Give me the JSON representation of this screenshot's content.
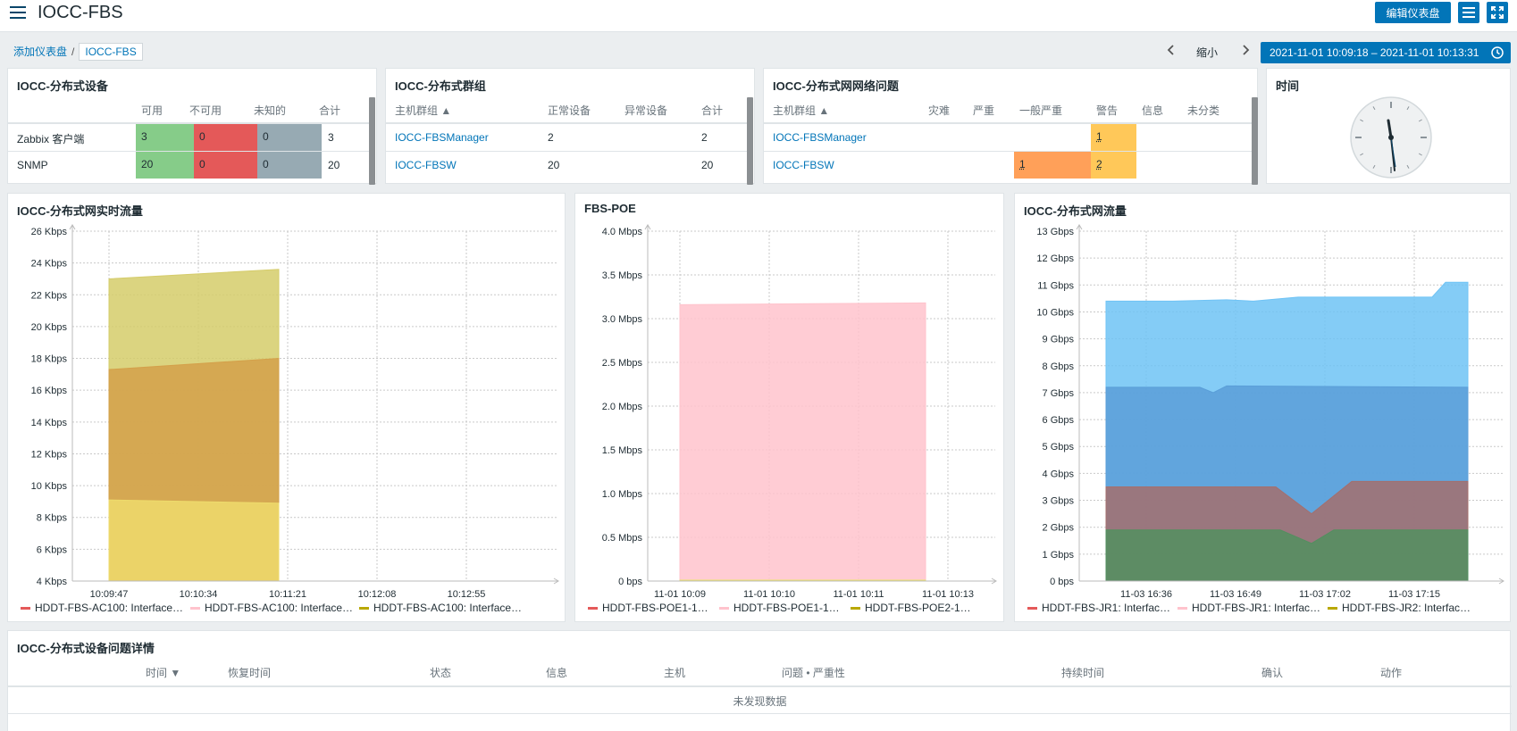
{
  "header": {
    "title": "IOCC-FBS",
    "edit_button": "编辑仪表盘"
  },
  "breadcrumb": {
    "parent": "添加仪表盘",
    "current": "IOCC-FBS"
  },
  "toolbar": {
    "zoom_label": "缩小",
    "time_range": "2021-11-01 10:09:18 – 2021-11-01 10:13:31"
  },
  "widgets": {
    "devices": {
      "title": "IOCC-分布式设备",
      "headers": [
        "可用",
        "不可用",
        "未知的",
        "合计"
      ],
      "rows": [
        {
          "name": "Zabbix 客户端",
          "available": "3",
          "unavailable": "0",
          "unknown": "0",
          "total": "3"
        },
        {
          "name": "SNMP",
          "available": "20",
          "unavailable": "0",
          "unknown": "0",
          "total": "20"
        }
      ]
    },
    "groups": {
      "title": "IOCC-分布式群组",
      "headers": [
        "主机群组 ▲",
        "正常设备",
        "异常设备",
        "合计"
      ],
      "rows": [
        {
          "name": "IOCC-FBSManager",
          "normal": "2",
          "abnormal": "",
          "total": "2"
        },
        {
          "name": "IOCC-FBSW",
          "normal": "20",
          "abnormal": "",
          "total": "20"
        }
      ]
    },
    "problems": {
      "title": "IOCC-分布式网网络问题",
      "headers": [
        "主机群组 ▲",
        "灾难",
        "严重",
        "一般严重",
        "警告",
        "信息",
        "未分类"
      ],
      "rows": [
        {
          "name": "IOCC-FBSManager",
          "average": "",
          "warning": "1"
        },
        {
          "name": "IOCC-FBSW",
          "average": "1",
          "warning": "2"
        }
      ]
    },
    "clock": {
      "title": "时间"
    },
    "graph1": {
      "title": "IOCC-分布式网实时流量",
      "legend": [
        "HDDT-FBS-AC100: Interface…",
        "HDDT-FBS-AC100: Interface…",
        "HDDT-FBS-AC100: Interface…"
      ]
    },
    "graph2": {
      "title": "FBS-POE",
      "legend": [
        "HDDT-FBS-POE1-1…",
        "HDDT-FBS-POE1-1…",
        "HDDT-FBS-POE2-1…"
      ]
    },
    "graph3": {
      "title": "IOCC-分布式网流量",
      "legend": [
        "HDDT-FBS-JR1: Interfac…",
        "HDDT-FBS-JR1: Interfac…",
        "HDDT-FBS-JR2: Interfac…"
      ]
    },
    "problem_details": {
      "title": "IOCC-分布式设备问题详情",
      "headers": [
        "时间 ▼",
        "恢复时间",
        "状态",
        "信息",
        "主机",
        "问题 • 严重性",
        "持续时间",
        "确认",
        "动作"
      ],
      "empty": "未发现数据"
    }
  },
  "colors": {
    "available": "#86cc89",
    "unavailable": "#e45959",
    "unknown": "#97aab3",
    "average": "#ffa059",
    "warning": "#ffc859",
    "accent": "#0275b8"
  },
  "chart_data": [
    {
      "type": "area",
      "title": "IOCC-分布式网实时流量",
      "x": [
        "10:09:47",
        "10:10:34",
        "10:11:21",
        "10:12:08",
        "10:12:55"
      ],
      "yticks": [
        "4 Kbps",
        "6 Kbps",
        "8 Kbps",
        "10 Kbps",
        "12 Kbps",
        "14 Kbps",
        "16 Kbps",
        "18 Kbps",
        "20 Kbps",
        "22 Kbps",
        "24 Kbps",
        "26 Kbps"
      ],
      "ylim": [
        4,
        26
      ],
      "series": [
        {
          "name": "HDDT-FBS-AC100: Interface…",
          "color": "#d5cc6a",
          "x": [
            0,
            1.9
          ],
          "values": [
            23.0,
            23.6
          ]
        },
        {
          "name": "HDDT-FBS-AC100: Interface…",
          "color": "#d4a04a",
          "x": [
            0,
            1.9
          ],
          "values": [
            17.3,
            18.0
          ]
        },
        {
          "name": "HDDT-FBS-AC100: Interface…",
          "color": "#eedb6c",
          "x": [
            0,
            1.9
          ],
          "values": [
            9.1,
            8.9
          ]
        }
      ]
    },
    {
      "type": "area",
      "title": "FBS-POE",
      "x": [
        "11-01 10:09",
        "11-01 10:10",
        "11-01 10:11",
        "11-01 10:13"
      ],
      "yticks": [
        "0 bps",
        "0.5 Mbps",
        "1.0 Mbps",
        "1.5 Mbps",
        "2.0 Mbps",
        "2.5 Mbps",
        "3.0 Mbps",
        "3.5 Mbps",
        "4.0 Mbps"
      ],
      "ylim": [
        0,
        4
      ],
      "series": [
        {
          "name": "HDDT-FBS-POE1-1…",
          "color": "#ffc3cc",
          "x": [
            0,
            2.75
          ],
          "values": [
            3.16,
            3.18
          ]
        },
        {
          "name": "HDDT-FBS-POE2-1…",
          "color": "#ede36a",
          "x": [
            0,
            2.75
          ],
          "values": [
            0.01,
            0.01
          ]
        }
      ]
    },
    {
      "type": "area",
      "title": "IOCC-分布式网流量",
      "x": [
        "11-03 16:36",
        "11-03 16:49",
        "11-03 17:02",
        "11-03 17:15"
      ],
      "yticks": [
        "0 bps",
        "1 Gbps",
        "2 Gbps",
        "3 Gbps",
        "4 Gbps",
        "5 Gbps",
        "6 Gbps",
        "7 Gbps",
        "8 Gbps",
        "9 Gbps",
        "10 Gbps",
        "11 Gbps",
        "12 Gbps",
        "13 Gbps"
      ],
      "ylim": [
        0,
        13
      ],
      "series": [
        {
          "name": "HDDT-FBS-JR1: Interfac…",
          "color": "#6fc3f5",
          "x": [
            -0.45,
            0.3,
            0.9,
            1.2,
            1.7,
            2.4,
            3.2,
            3.35,
            3.6
          ],
          "values": [
            10.4,
            10.4,
            10.45,
            10.4,
            10.55,
            10.55,
            10.55,
            11.1,
            11.1
          ]
        },
        {
          "name": "HDDT-FBS-JR1: Interfac…",
          "color": "#5a9ed8",
          "x": [
            -0.45,
            0.6,
            0.75,
            0.9,
            3.6
          ],
          "values": [
            7.2,
            7.2,
            7.0,
            7.25,
            7.2
          ]
        },
        {
          "name": "HDDT-FBS-JR2: Interfac…",
          "color": "#a46f6d",
          "x": [
            -0.45,
            1.45,
            1.85,
            2.3,
            3.6
          ],
          "values": [
            3.5,
            3.5,
            2.5,
            3.7,
            3.7
          ]
        },
        {
          "name": "",
          "color": "#528f5f",
          "x": [
            -0.45,
            1.5,
            1.85,
            2.1,
            3.6
          ],
          "values": [
            1.9,
            1.9,
            1.4,
            1.9,
            1.9
          ]
        }
      ]
    }
  ]
}
